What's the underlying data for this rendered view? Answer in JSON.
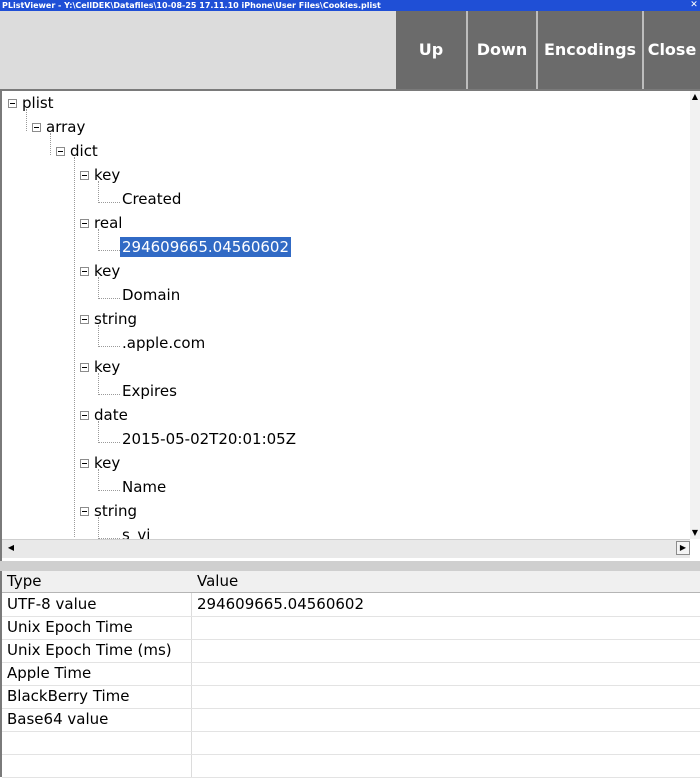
{
  "window": {
    "title": "PListViewer - Y:\\CellDEK\\Datafiles\\10-08-25  17.11.10 iPhone\\User Files\\Cookies.plist",
    "close_glyph": "✕"
  },
  "toolbar": {
    "up_label": "Up",
    "down_label": "Down",
    "encodings_label": "Encodings",
    "close_label": "Close"
  },
  "tree": {
    "nodes": [
      {
        "label": "plist"
      },
      {
        "label": "array"
      },
      {
        "label": "dict"
      },
      {
        "label": "key"
      },
      {
        "label": "Created"
      },
      {
        "label": "real"
      },
      {
        "label": "294609665.04560602"
      },
      {
        "label": "key"
      },
      {
        "label": "Domain"
      },
      {
        "label": "string"
      },
      {
        "label": ".apple.com"
      },
      {
        "label": "key"
      },
      {
        "label": "Expires"
      },
      {
        "label": "date"
      },
      {
        "label": "2015-05-02T20:01:05Z"
      },
      {
        "label": "key"
      },
      {
        "label": "Name"
      },
      {
        "label": "string"
      },
      {
        "label": "s_vi"
      }
    ]
  },
  "scrollbars": {
    "up_glyph": "▲",
    "down_glyph": "▼",
    "left_glyph": "◀",
    "right_glyph": "▶"
  },
  "grid": {
    "headers": {
      "type": "Type",
      "value": "Value"
    },
    "rows": [
      {
        "type": "UTF-8 value",
        "value": "294609665.04560602"
      },
      {
        "type": "Unix Epoch Time",
        "value": ""
      },
      {
        "type": "Unix Epoch Time (ms)",
        "value": ""
      },
      {
        "type": "Apple Time",
        "value": ""
      },
      {
        "type": "BlackBerry Time",
        "value": ""
      },
      {
        "type": "Base64 value",
        "value": ""
      },
      {
        "type": "",
        "value": ""
      },
      {
        "type": "",
        "value": ""
      }
    ]
  },
  "colors": {
    "titlebar": "#1f4fd6",
    "toolbar_button": "#6b6b6b",
    "selection": "#316ac5"
  }
}
